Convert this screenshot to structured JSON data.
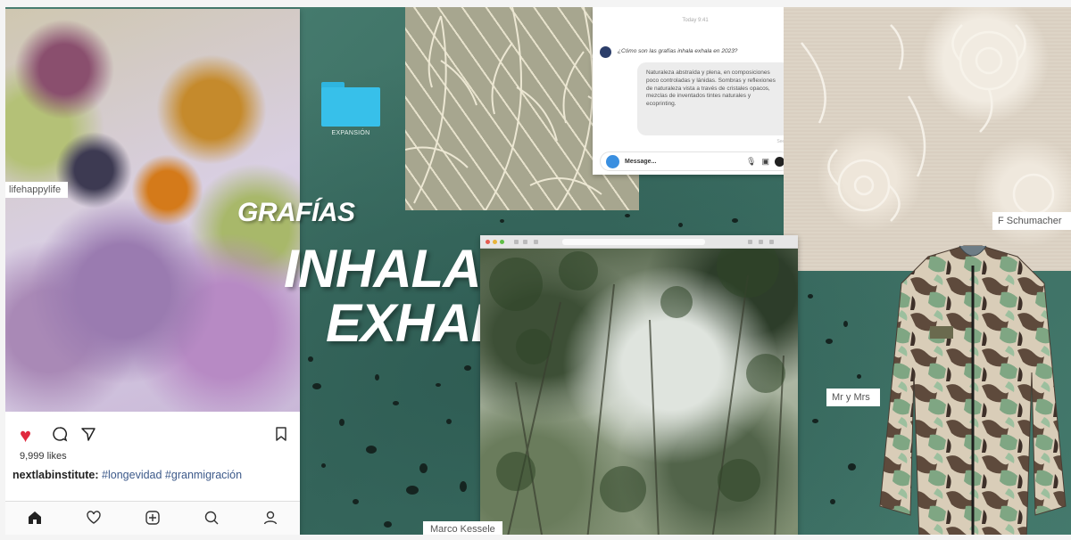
{
  "instagram": {
    "tag": "lifehappylife",
    "likes": "9,999 likes",
    "caption_user": "nextlabinstitute:",
    "caption_tags": "#longevidad #granmigración",
    "icons": [
      "heart-icon",
      "comment-icon",
      "share-icon",
      "bookmark-icon"
    ],
    "nav": [
      "home-icon",
      "heart-icon",
      "add-icon",
      "search-icon",
      "profile-icon"
    ],
    "colors": {
      "heart": "#e0293e"
    }
  },
  "folder": {
    "label": "EXPANSIÓN",
    "color": "#37c0ea"
  },
  "chat": {
    "time": "Today 9:41",
    "question": "¿Cómo son las grafías inhala exhala en 2023?",
    "answer": "Naturaleza abstraída y plena, en composiciones poco controladas y lánidas. Sombras y reflexiones de naturaleza vista a través de cristales opacos, mezclas de inventados tintes naturales y ecoprinting.",
    "seen": "Seen",
    "input_placeholder": "Message..."
  },
  "title": {
    "line1": "GRAFÍAS",
    "line2": "INHALA",
    "line3": "EXHALA"
  },
  "credits": {
    "floral": "F Schumacher",
    "trees": "Marco Kessele",
    "jacket": "Mr y Mrs"
  }
}
